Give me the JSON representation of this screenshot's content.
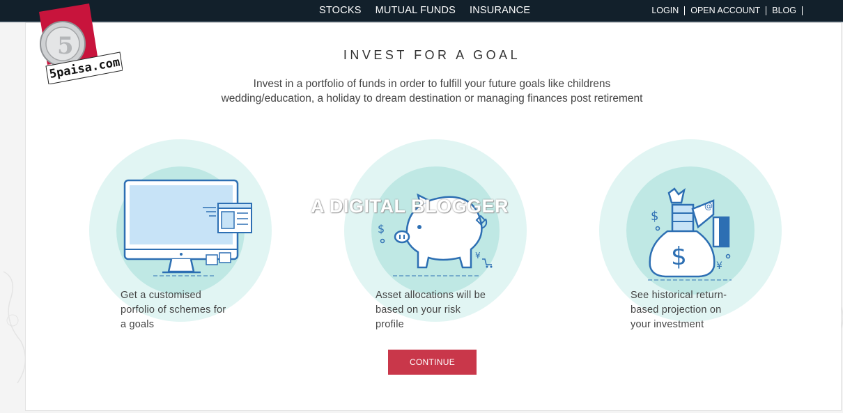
{
  "nav": {
    "center_items": [
      "STOCKS",
      "MUTUAL FUNDS",
      "INSURANCE"
    ],
    "right_items": [
      "LOGIN",
      "OPEN ACCOUNT",
      "BLOG"
    ]
  },
  "logo": {
    "text": "5paisa.com"
  },
  "main": {
    "heading": "INVEST FOR A GOAL",
    "subtext_line1": "Invest in a portfolio of funds in order to fulfill your future goals like childrens",
    "subtext_line2": "wedding/education, a holiday to dream destination or managing finances post retirement",
    "features": [
      {
        "icon": "desktop-monitor-icon",
        "line1": "Get a customised",
        "line2": "porfolio of schemes for",
        "line3": "a goals"
      },
      {
        "icon": "piggy-bank-icon",
        "line1": "Asset allocations will be",
        "line2": "based on your risk",
        "line3": "profile"
      },
      {
        "icon": "money-bag-icon",
        "line1": "See historical return-",
        "line2": "based projection on",
        "line3": "your investment"
      }
    ],
    "continue_label": "CONTINUE"
  },
  "watermark": "A DIGITAL BLOGGER",
  "colors": {
    "topbar": "#12202b",
    "accent": "#c9374a",
    "circle_outer": "#e1f5f3",
    "circle_inner": "#bfe8e4",
    "icon_stroke": "#2d6fb3",
    "icon_fill": "#c7e3f7"
  }
}
